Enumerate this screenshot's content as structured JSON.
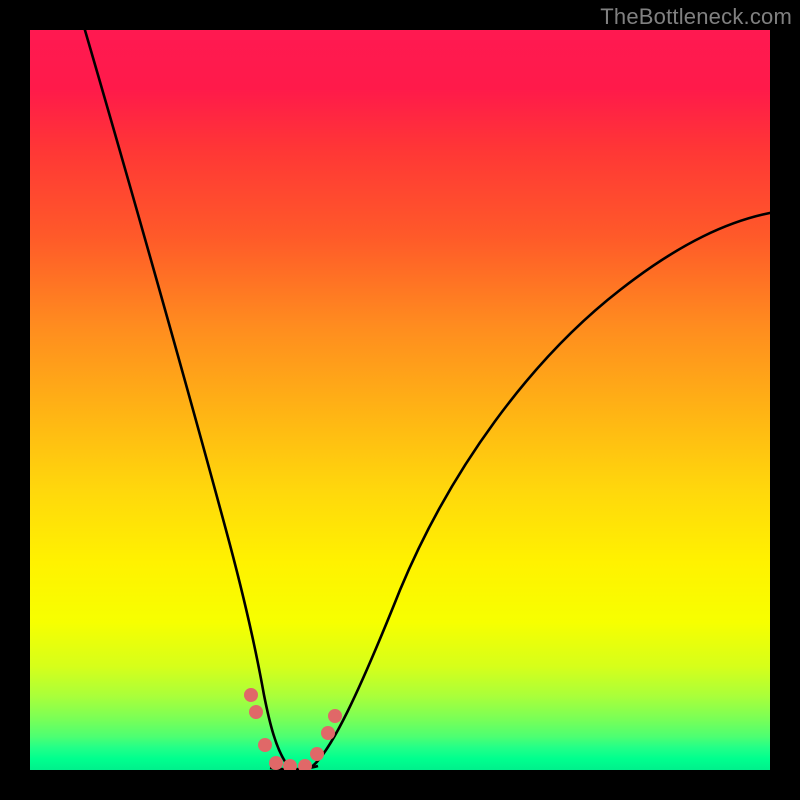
{
  "watermark": "TheBottleneck.com",
  "chart_data": {
    "type": "line",
    "title": "",
    "xlabel": "",
    "ylabel": "",
    "xlim": [
      0,
      100
    ],
    "ylim": [
      0,
      100
    ],
    "series": [
      {
        "name": "curve",
        "x": [
          7,
          10,
          14,
          18,
          22,
          25,
          27,
          29,
          30.5,
          32,
          33.5,
          35,
          37,
          40,
          44,
          50,
          58,
          66,
          74,
          82,
          90,
          100
        ],
        "y": [
          100,
          88,
          74,
          60,
          46,
          34,
          24,
          15,
          8,
          3,
          0,
          0,
          0,
          3,
          10,
          22,
          37,
          49,
          58,
          65,
          70,
          74
        ]
      }
    ],
    "markers": {
      "name": "highlight-dots",
      "color": "#e06868",
      "points": [
        {
          "x": 29.5,
          "y": 10
        },
        {
          "x": 30.3,
          "y": 7.5
        },
        {
          "x": 31.5,
          "y": 3
        },
        {
          "x": 33,
          "y": 0.5
        },
        {
          "x": 35,
          "y": 0.5
        },
        {
          "x": 37,
          "y": 0.5
        },
        {
          "x": 38.5,
          "y": 2.5
        },
        {
          "x": 40,
          "y": 5
        },
        {
          "x": 41,
          "y": 7.5
        }
      ]
    }
  }
}
